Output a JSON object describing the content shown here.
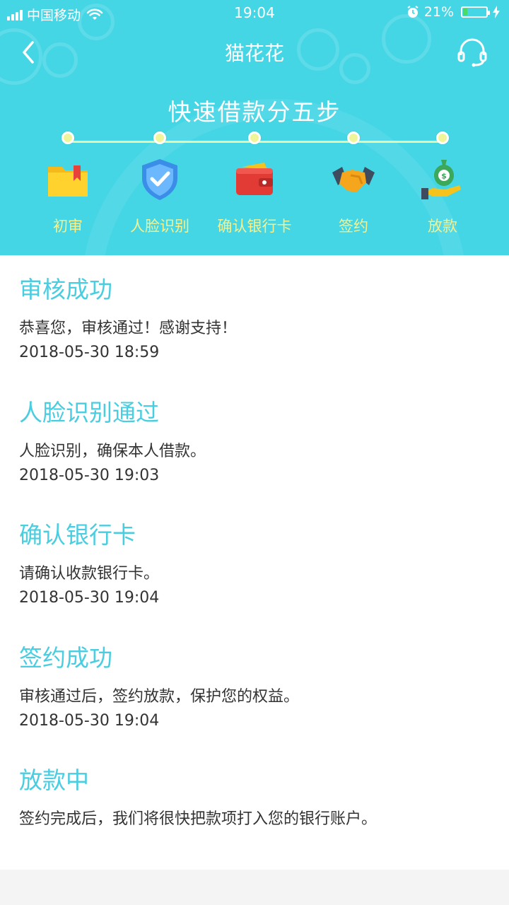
{
  "status_bar": {
    "carrier": "中国移动",
    "time": "19:04",
    "battery_percent": "21%",
    "battery_level": 0.21
  },
  "nav": {
    "title": "猫花花",
    "back_icon": "chevron-left-icon",
    "support_icon": "headset-icon"
  },
  "hero": {
    "heading": "快速借款分五步",
    "steps": [
      {
        "label": "初审",
        "icon": "folder-icon"
      },
      {
        "label": "人脸识别",
        "icon": "shield-check-icon"
      },
      {
        "label": "确认银行卡",
        "icon": "wallet-icon"
      },
      {
        "label": "签约",
        "icon": "handshake-icon"
      },
      {
        "label": "放款",
        "icon": "money-bag-icon"
      }
    ]
  },
  "timeline": [
    {
      "title": "审核成功",
      "desc": "恭喜您，审核通过！感谢支持！",
      "time": "2018-05-30 18:59"
    },
    {
      "title": "人脸识别通过",
      "desc": "人脸识别，确保本人借款。",
      "time": "2018-05-30 19:03"
    },
    {
      "title": "确认银行卡",
      "desc": "请确认收款银行卡。",
      "time": "2018-05-30 19:04"
    },
    {
      "title": "签约成功",
      "desc": "审核通过后，签约放款，保护您的权益。",
      "time": "2018-05-30 19:04"
    },
    {
      "title": "放款中",
      "desc": "签约完成后，我们将很快把款项打入您的银行账户。",
      "time": ""
    }
  ],
  "colors": {
    "header_bg": "#45d6e6",
    "title_accent": "#49cde0",
    "step_label": "#f8f18a"
  }
}
